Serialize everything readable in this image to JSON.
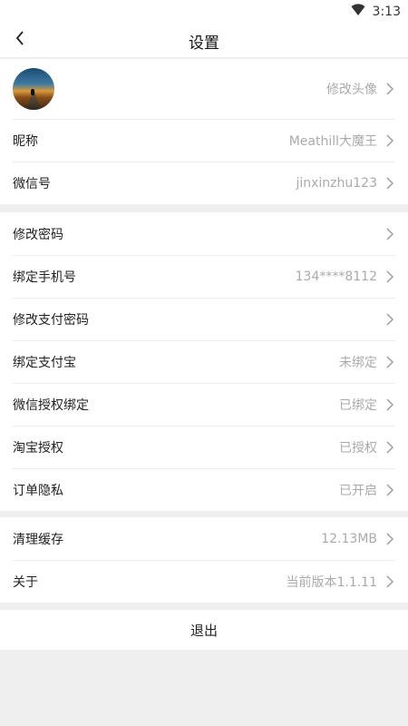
{
  "status_bar": {
    "time": "3:13",
    "wifi_icon": "wifi-icon"
  },
  "header": {
    "title": "设置",
    "back_icon": "chevron-left-icon"
  },
  "profile": {
    "avatar_label": "修改头像",
    "nickname_label": "昵称",
    "nickname_value": "Meathill大魔王",
    "wechat_label": "微信号",
    "wechat_value": "jinxinzhu123"
  },
  "account": {
    "items": [
      {
        "label": "修改密码",
        "value": ""
      },
      {
        "label": "绑定手机号",
        "value": "134****8112"
      },
      {
        "label": "修改支付密码",
        "value": ""
      },
      {
        "label": "绑定支付宝",
        "value": "未绑定"
      },
      {
        "label": "微信授权绑定",
        "value": "已绑定"
      },
      {
        "label": "淘宝授权",
        "value": "已授权"
      },
      {
        "label": "订单隐私",
        "value": "已开启"
      }
    ]
  },
  "misc": {
    "cache_label": "清理缓存",
    "cache_value": "12.13MB",
    "about_label": "关于",
    "about_value": "当前版本1.1.11"
  },
  "logout_label": "退出",
  "colors": {
    "background": "#efefef",
    "value_text": "#aaaaaa",
    "chevron": "#999999"
  }
}
